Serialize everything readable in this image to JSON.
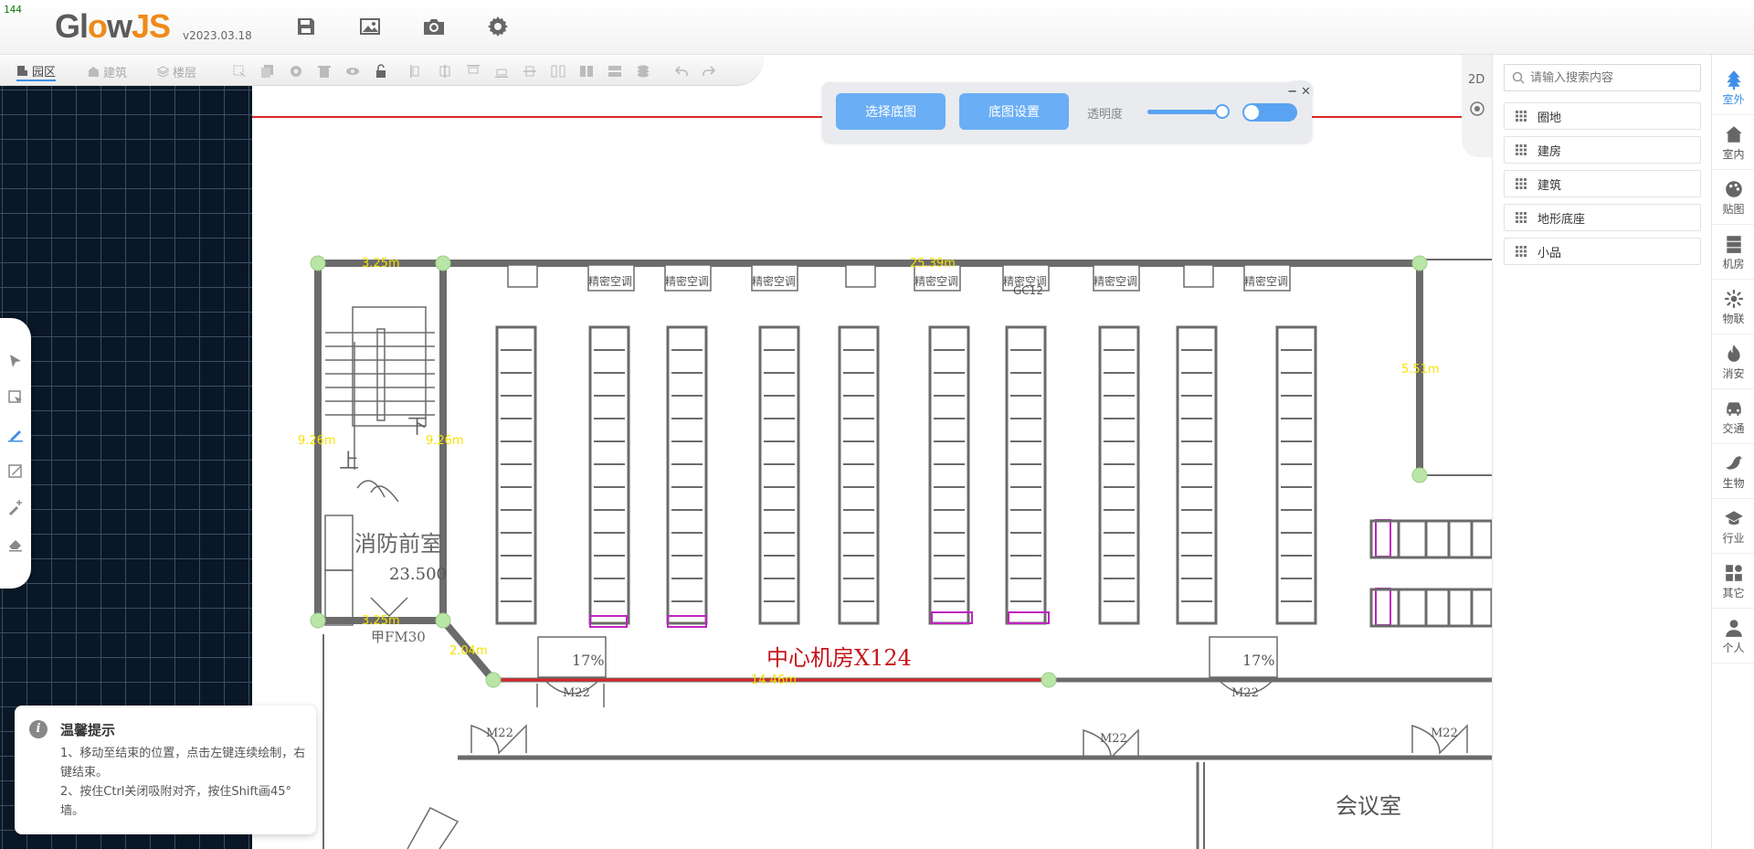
{
  "header": {
    "fps": "144",
    "logo_text": "GlowJS",
    "version": "v2023.03.18",
    "tools": [
      {
        "name": "save-icon",
        "label": "save"
      },
      {
        "name": "image-icon",
        "label": "image"
      },
      {
        "name": "camera-icon",
        "label": "camera"
      },
      {
        "name": "settings-icon",
        "label": "settings"
      }
    ]
  },
  "toolbar2": {
    "tabs": [
      {
        "label": "园区",
        "active": true
      },
      {
        "label": "建筑",
        "active": false
      },
      {
        "label": "楼层",
        "active": false
      }
    ]
  },
  "floorplan_panel": {
    "select_button": "选择底图",
    "settings_button": "底图设置",
    "opacity_label": "透明度",
    "opacity_value": 0.85,
    "toggle_on": true
  },
  "canvas": {
    "dimensions": [
      "3.25m",
      "25.39m",
      "9.26m",
      "9.26m",
      "5.51m",
      "3.25m",
      "2.04m",
      "14.46m"
    ],
    "room_labels": {
      "center": "中心机房X124",
      "meeting": "会议室",
      "fire_front": "消防前室",
      "fire_level": "23.500",
      "up": "上",
      "down": "下",
      "door": "甲FM30",
      "ac": "精密空调",
      "ac_code": "GC12",
      "slope1": "17%",
      "slope2": "17%",
      "door_m22": "M22"
    }
  },
  "tips": {
    "title": "温馨提示",
    "line1": "1、移动至结束的位置，点击左键连续绘制，右键结束。",
    "line2": "2、按住Ctrl关闭吸附对齐，按住Shift画45°墙。"
  },
  "view": {
    "mode_2d": "2D"
  },
  "library": {
    "search_placeholder": "请输入搜索内容",
    "items": [
      "圈地",
      "建房",
      "建筑",
      "地形底座",
      "小品"
    ]
  },
  "categories": [
    {
      "label": "室外",
      "icon": "tree-icon",
      "active": true
    },
    {
      "label": "室内",
      "icon": "home-icon",
      "active": false
    },
    {
      "label": "贴图",
      "icon": "palette-icon",
      "active": false
    },
    {
      "label": "机房",
      "icon": "server-icon",
      "active": false
    },
    {
      "label": "物联",
      "icon": "iot-icon",
      "active": false
    },
    {
      "label": "消安",
      "icon": "fire-icon",
      "active": false
    },
    {
      "label": "交通",
      "icon": "car-icon",
      "active": false
    },
    {
      "label": "生物",
      "icon": "bird-icon",
      "active": false
    },
    {
      "label": "行业",
      "icon": "graduation-icon",
      "active": false
    },
    {
      "label": "其它",
      "icon": "apps-icon",
      "active": false
    },
    {
      "label": "个人",
      "icon": "user-icon",
      "active": false
    }
  ],
  "colors": {
    "accent": "#3d8ee8",
    "button_blue": "#6aaef5",
    "grid_bg": "#0a1726",
    "wall": "#6b6b6b",
    "vertex": "#b9e6a6",
    "dim_text": "#f5e100",
    "red_line": "#d9262b",
    "magenta": "#c024c0"
  }
}
